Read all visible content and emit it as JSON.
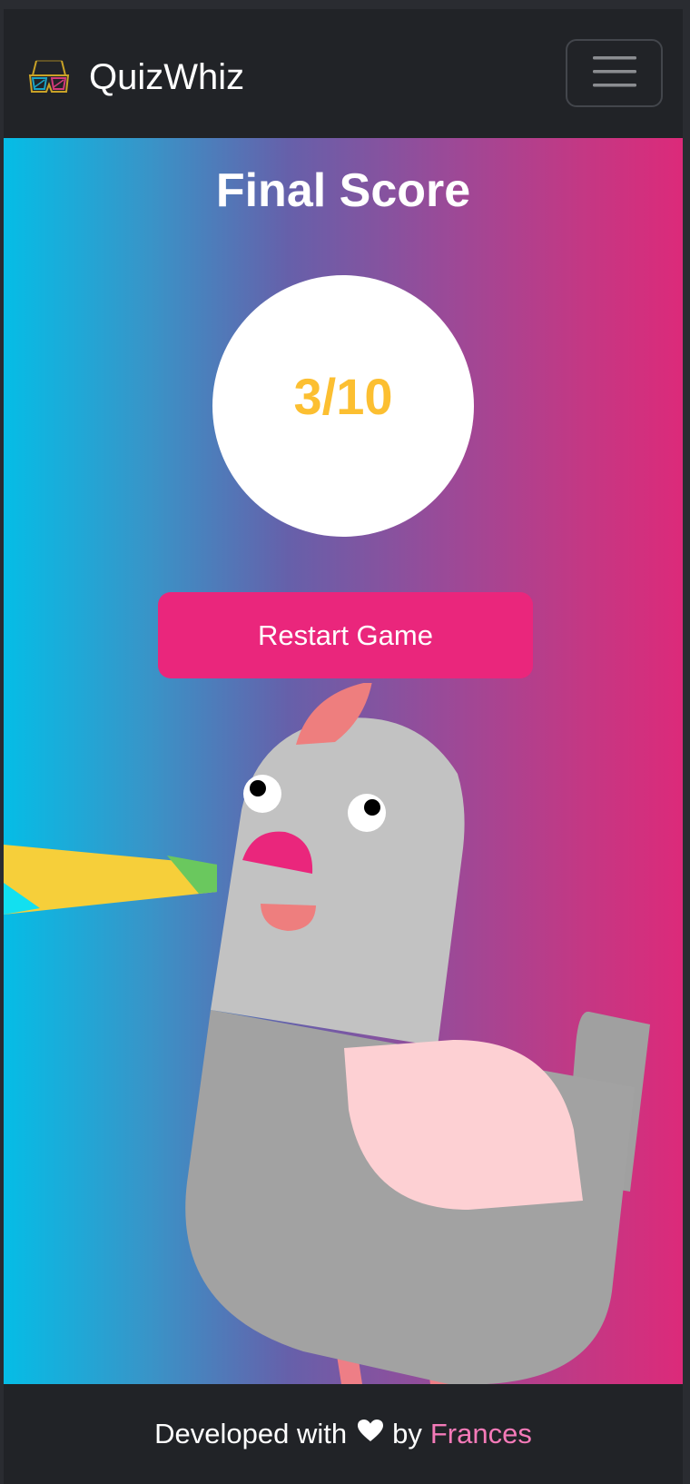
{
  "navbar": {
    "brand_name": "QuizWhiz",
    "logo_icon": "3d-glasses-icon",
    "menu_icon": "hamburger-menu-icon"
  },
  "result": {
    "title": "Final Score",
    "score": "3/10",
    "restart_label": "Restart Game"
  },
  "illustration": "pigeon-illustration",
  "footer": {
    "prefix": "Developed with",
    "heart_icon": "heart-icon",
    "by": "by",
    "author": "Frances"
  },
  "colors": {
    "navbar_bg": "#212327",
    "gradient_start": "#05bde6",
    "gradient_end": "#dc2a7a",
    "score_color": "#fcbf31",
    "button_bg": "#ea267c",
    "author_link": "#f47ab8"
  }
}
